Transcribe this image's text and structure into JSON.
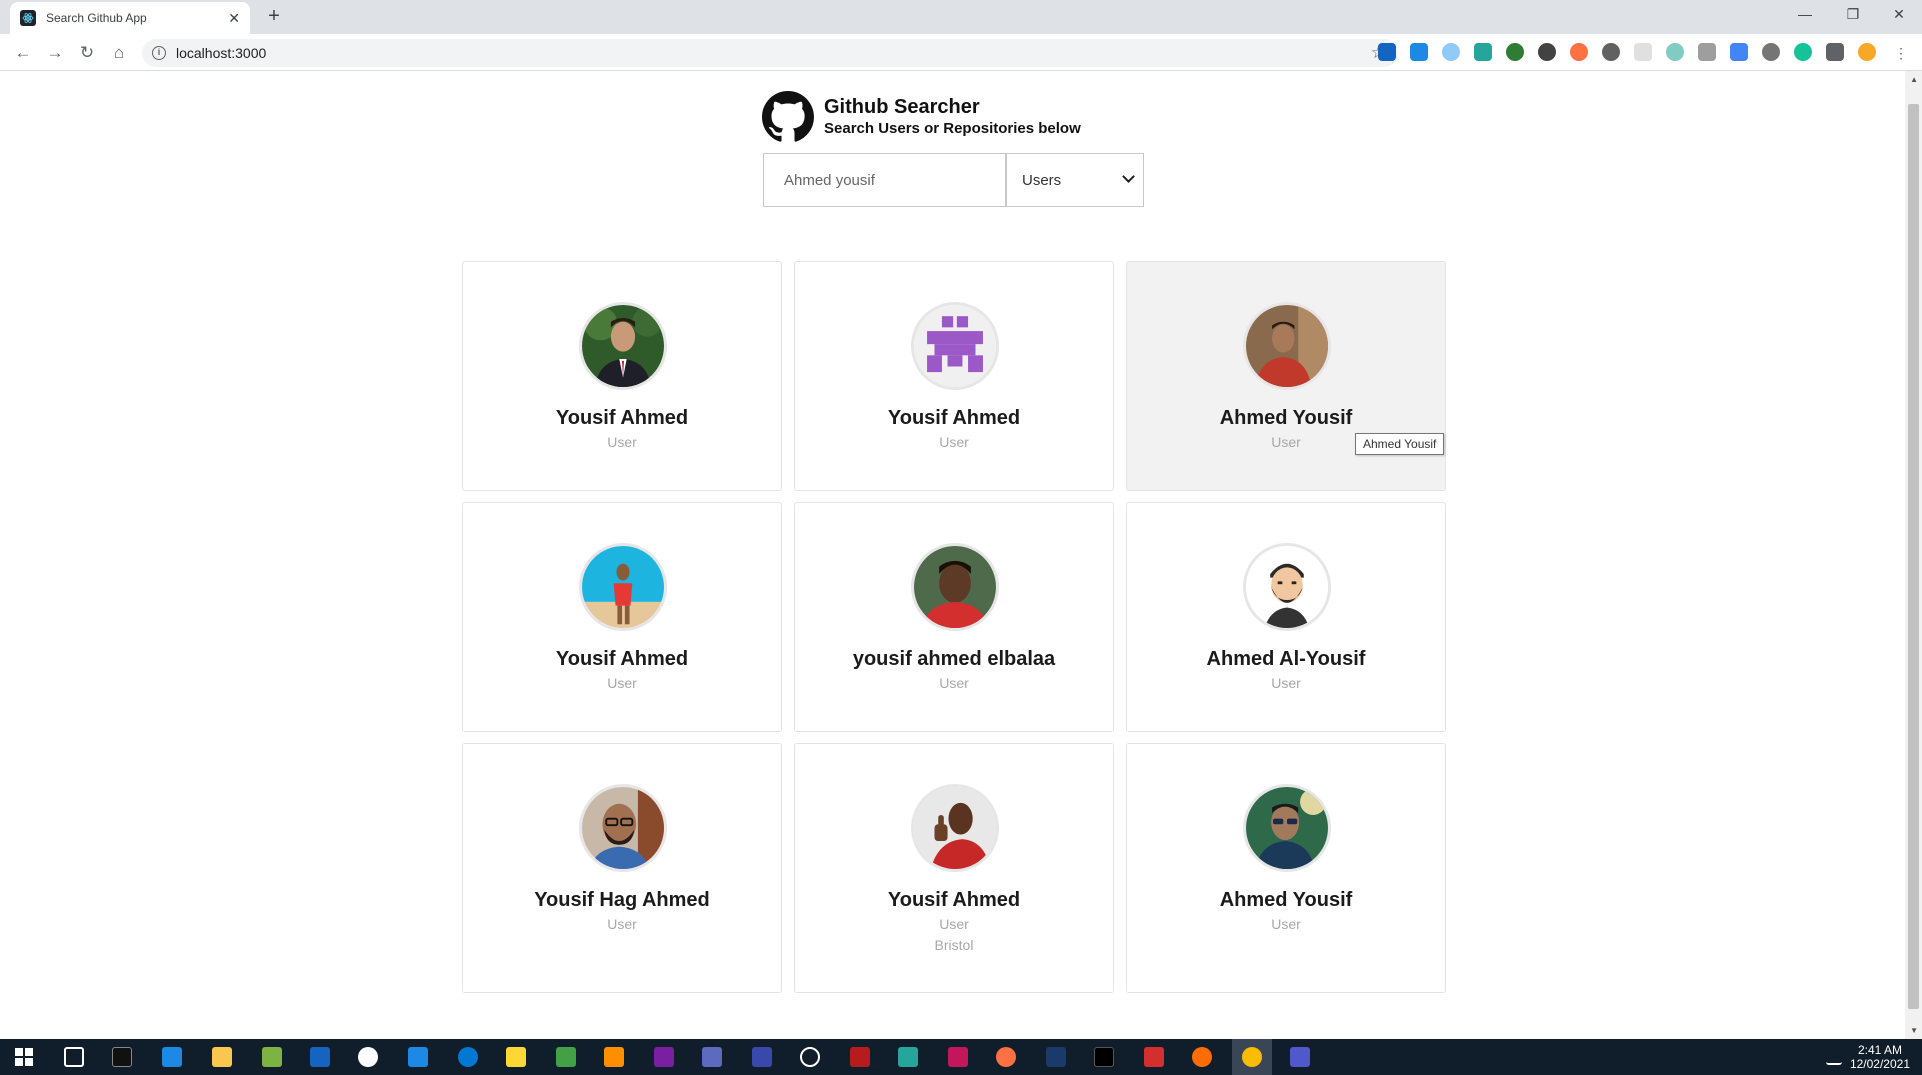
{
  "browser": {
    "tab_title": "Search Github App",
    "url": "localhost:3000"
  },
  "page": {
    "title": "Github Searcher",
    "subtitle": "Search Users or Repositories below",
    "search": {
      "value": "Ahmed yousif"
    },
    "search_type": {
      "selected": "Users"
    }
  },
  "results": [
    {
      "name": "Yousif Ahmed",
      "type": "User",
      "avatar": "photo-suit-icon"
    },
    {
      "name": "Yousif Ahmed",
      "type": "User",
      "avatar": "identicon-icon"
    },
    {
      "name": "Ahmed Yousif",
      "type": "User",
      "avatar": "photo-red-shirt-icon"
    },
    {
      "name": "Yousif Ahmed",
      "type": "User",
      "avatar": "photo-beach-icon"
    },
    {
      "name": "yousif ahmed elbalaa",
      "type": "User",
      "avatar": "photo-face-icon"
    },
    {
      "name": "Ahmed Al-Yousif",
      "type": "User",
      "avatar": "cartoon-beard-icon"
    },
    {
      "name": "Yousif Hag Ahmed",
      "type": "User",
      "avatar": "photo-glasses-icon"
    },
    {
      "name": "Yousif Ahmed",
      "type": "User",
      "location": "Bristol",
      "avatar": "photo-thumbs-up-icon"
    },
    {
      "name": "Ahmed Yousif",
      "type": "User",
      "avatar": "photo-sunglasses-icon"
    }
  ],
  "tooltip": "Ahmed Yousif",
  "taskbar": {
    "time": "2:41 AM",
    "date": "12/02/2021"
  },
  "colors": {
    "hover_card": "#f2f2f2",
    "taskbar": "#101d2b",
    "muted_text": "#a8a8a8"
  }
}
